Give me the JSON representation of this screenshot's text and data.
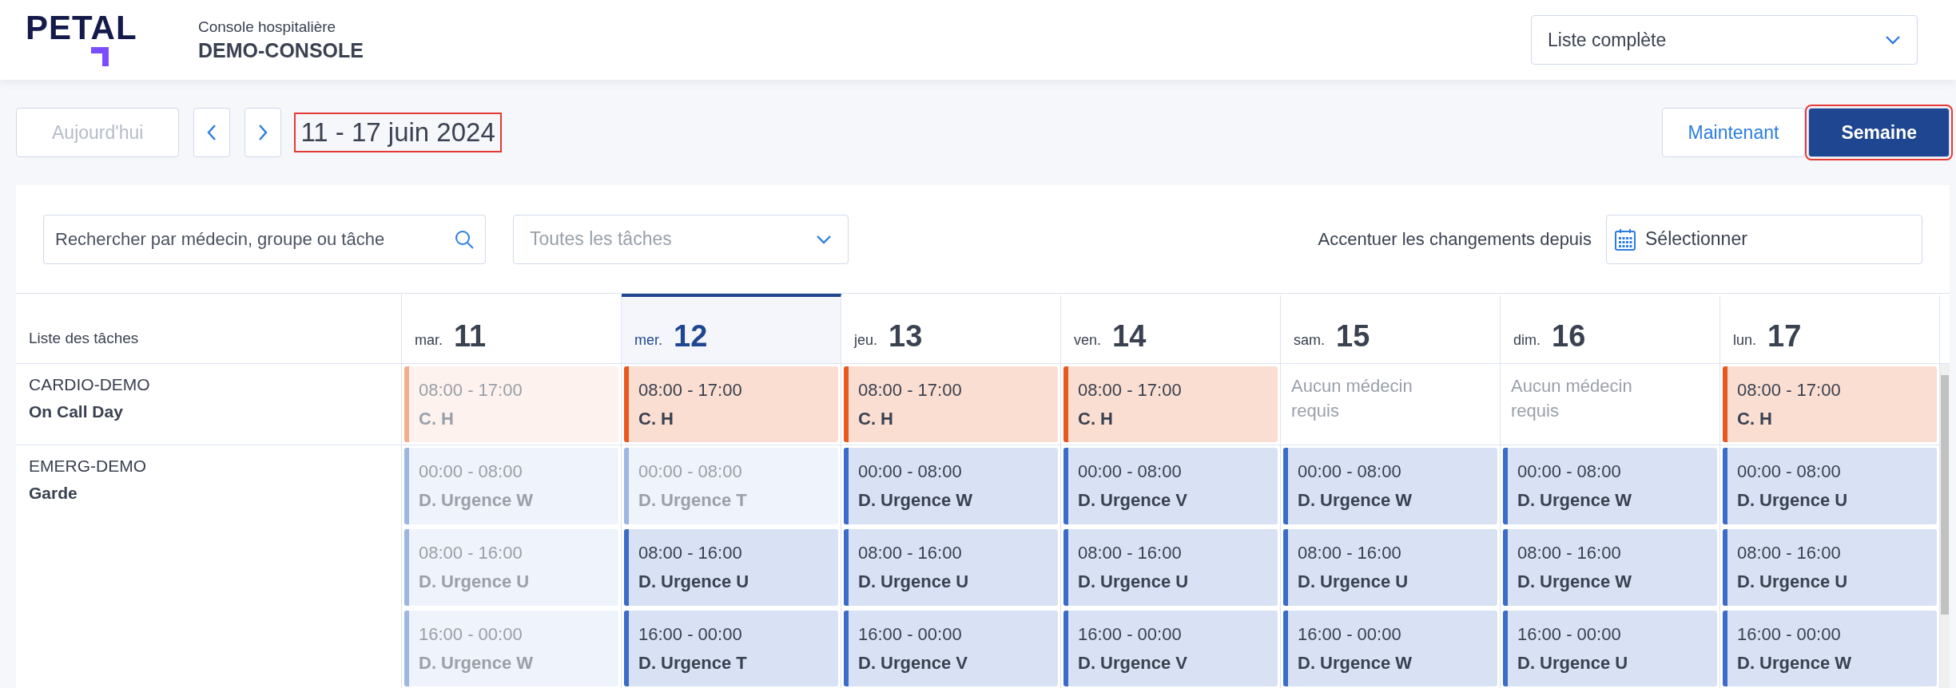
{
  "header": {
    "logo": "PETAL",
    "subtitle": "Console hospitalière",
    "title": "DEMO-CONSOLE",
    "list_select": {
      "value": "Liste complète"
    }
  },
  "toolbar": {
    "today_button": {
      "label": "Aujourd'hui",
      "disabled": true
    },
    "date_range": {
      "text": "11 - 17 juin 2024",
      "highlighted": true
    },
    "views": [
      {
        "label": "Maintenant",
        "selected": false,
        "highlighted": false
      },
      {
        "label": "Semaine",
        "selected": true,
        "highlighted": true
      }
    ]
  },
  "filters": {
    "search": {
      "placeholder": "Rechercher par médecin, groupe ou tâche"
    },
    "task_select": {
      "placeholder": "Toutes les tâches"
    },
    "highlight_label": "Accentuer les changements depuis",
    "date_picker": {
      "value": "Sélectionner"
    }
  },
  "table": {
    "first_column": "Liste des tâches",
    "days": [
      {
        "weekday": "mar.",
        "day": "11",
        "selected": false
      },
      {
        "weekday": "mer.",
        "day": "12",
        "selected": true
      },
      {
        "weekday": "jeu.",
        "day": "13",
        "selected": false
      },
      {
        "weekday": "ven.",
        "day": "14",
        "selected": false
      },
      {
        "weekday": "sam.",
        "day": "15",
        "selected": false
      },
      {
        "weekday": "dim.",
        "day": "16",
        "selected": false
      },
      {
        "weekday": "lun.",
        "day": "17",
        "selected": false
      }
    ],
    "rows": [
      {
        "group": "CARDIO-DEMO",
        "task": "On Call Day",
        "color": "#e8581f",
        "slots": [
          [
            {
              "kind": "shift",
              "time": "08:00 - 17:00",
              "doctor": "C. H",
              "past": true
            },
            {
              "kind": "shift",
              "time": "08:00 - 17:00",
              "doctor": "C. H",
              "past": false
            },
            {
              "kind": "shift",
              "time": "08:00 - 17:00",
              "doctor": "C. H",
              "past": false
            },
            {
              "kind": "shift",
              "time": "08:00 - 17:00",
              "doctor": "C. H",
              "past": false
            },
            {
              "kind": "empty",
              "text": "Aucun médecin requis"
            },
            {
              "kind": "empty",
              "text": "Aucun médecin requis"
            },
            {
              "kind": "shift",
              "time": "08:00 - 17:00",
              "doctor": "C. H",
              "past": false
            }
          ]
        ]
      },
      {
        "group": "EMERG-DEMO",
        "task": "Garde",
        "color": "#3b6cc7",
        "slots": [
          [
            {
              "kind": "shift",
              "time": "00:00 - 08:00",
              "doctor": "D. Urgence W",
              "past": true
            },
            {
              "kind": "shift",
              "time": "00:00 - 08:00",
              "doctor": "D. Urgence T",
              "past": true
            },
            {
              "kind": "shift",
              "time": "00:00 - 08:00",
              "doctor": "D. Urgence W",
              "past": false
            },
            {
              "kind": "shift",
              "time": "00:00 - 08:00",
              "doctor": "D. Urgence V",
              "past": false
            },
            {
              "kind": "shift",
              "time": "00:00 - 08:00",
              "doctor": "D. Urgence W",
              "past": false
            },
            {
              "kind": "shift",
              "time": "00:00 - 08:00",
              "doctor": "D. Urgence W",
              "past": false
            },
            {
              "kind": "shift",
              "time": "00:00 - 08:00",
              "doctor": "D. Urgence U",
              "past": false
            }
          ],
          [
            {
              "kind": "shift",
              "time": "08:00 - 16:00",
              "doctor": "D. Urgence U",
              "past": true
            },
            {
              "kind": "shift",
              "time": "08:00 - 16:00",
              "doctor": "D. Urgence U",
              "past": false
            },
            {
              "kind": "shift",
              "time": "08:00 - 16:00",
              "doctor": "D. Urgence U",
              "past": false
            },
            {
              "kind": "shift",
              "time": "08:00 - 16:00",
              "doctor": "D. Urgence U",
              "past": false
            },
            {
              "kind": "shift",
              "time": "08:00 - 16:00",
              "doctor": "D. Urgence U",
              "past": false
            },
            {
              "kind": "shift",
              "time": "08:00 - 16:00",
              "doctor": "D. Urgence W",
              "past": false
            },
            {
              "kind": "shift",
              "time": "08:00 - 16:00",
              "doctor": "D. Urgence U",
              "past": false
            }
          ],
          [
            {
              "kind": "shift",
              "time": "16:00 - 00:00",
              "doctor": "D. Urgence W",
              "past": true
            },
            {
              "kind": "shift",
              "time": "16:00 - 00:00",
              "doctor": "D. Urgence T",
              "past": false
            },
            {
              "kind": "shift",
              "time": "16:00 - 00:00",
              "doctor": "D. Urgence V",
              "past": false
            },
            {
              "kind": "shift",
              "time": "16:00 - 00:00",
              "doctor": "D. Urgence V",
              "past": false
            },
            {
              "kind": "shift",
              "time": "16:00 - 00:00",
              "doctor": "D. Urgence W",
              "past": false
            },
            {
              "kind": "shift",
              "time": "16:00 - 00:00",
              "doctor": "D. Urgence U",
              "past": false
            },
            {
              "kind": "shift",
              "time": "16:00 - 00:00",
              "doctor": "D. Urgence W",
              "past": false
            }
          ]
        ]
      }
    ]
  }
}
